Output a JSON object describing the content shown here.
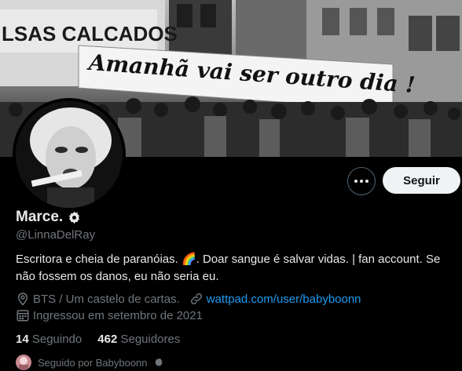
{
  "banner": {
    "sign_text": "Amanhã vai ser outro dia !",
    "store_text": "LSAS CALCADOS"
  },
  "profile": {
    "name": "Marce.",
    "handle": "@LinnaDelRay",
    "bio_line1": "Escritora e cheia de paranóias. 🌈. Doar sangue é salvar vidas. | fan account. Se",
    "bio_line2": "não fossem os danos, eu não seria eu.",
    "location": "BTS / Um castelo de cartas.",
    "website": "wattpad.com/user/babyboonn",
    "joined": "Ingressou em setembro de 2021"
  },
  "actions": {
    "follow_label": "Seguir",
    "more_label": "•••"
  },
  "stats": {
    "following_count": "14",
    "following_label": "Seguindo",
    "followers_count": "462",
    "followers_label": "Seguidores"
  },
  "followed_by": "Seguido por Babyboonn",
  "colors": {
    "link": "#1d9bf0",
    "muted": "#71767b",
    "text": "#e7e9ea",
    "button": "#eff3f4"
  }
}
